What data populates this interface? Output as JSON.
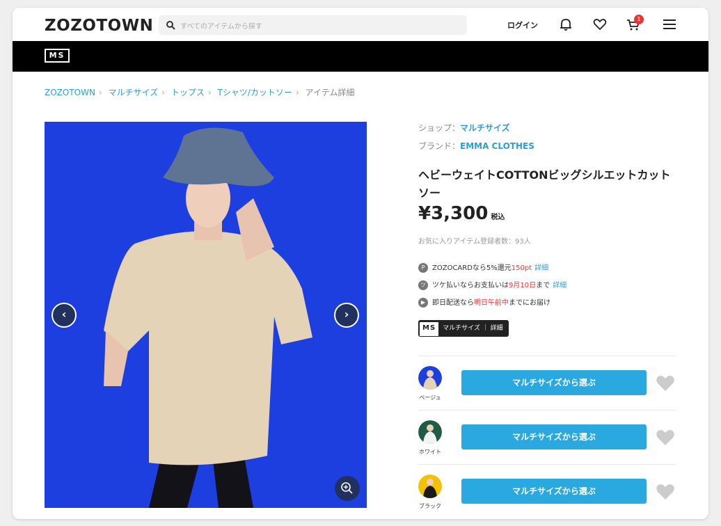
{
  "header": {
    "logo": "ZOZOTOWN",
    "search_placeholder": "すべてのアイテムから探す",
    "login_label": "ログイン",
    "cart_count": "1"
  },
  "msbar": {
    "logo": "MS"
  },
  "breadcrumb": [
    {
      "label": "ZOZOTOWN"
    },
    {
      "label": "マルチサイズ"
    },
    {
      "label": "トップス"
    },
    {
      "label": "Tシャツ/カットソー"
    },
    {
      "label": "アイテム詳細"
    }
  ],
  "product": {
    "shop_label": "ショップ：",
    "shop_value": "マルチサイズ",
    "brand_label": "ブランド：",
    "brand_value": "EMMA CLOTHES",
    "title": "ヘビーウェイトCOTTONビッグシルエットカットソー",
    "price": "¥3,300",
    "tax": "税込",
    "favorites": "お気に入りアイテム登録者数：93人",
    "perks": {
      "card_pre": "ZOZOCARDなら5%還元",
      "card_pt": "150pt",
      "card_link": "詳細",
      "tsuke_pre": "ツケ払いならお支払いは",
      "tsuke_date": "9月10日",
      "tsuke_post": "まで",
      "tsuke_link": "詳細",
      "ship_pre": "即日配送なら",
      "ship_red": "明日午前中",
      "ship_post": "までにお届け"
    },
    "ms_badge": {
      "ms": "MS",
      "text": "マルチサイズ ｜ 詳細"
    }
  },
  "variants": [
    {
      "label": "ベージュ",
      "button": "マルチサイズから選ぶ"
    },
    {
      "label": "ホワイト",
      "button": "マルチサイズから選ぶ"
    },
    {
      "label": "ブラック",
      "button": "マルチサイズから選ぶ"
    }
  ],
  "colors": {
    "accent": "#2aa9e0",
    "link": "#2a9fd6",
    "red": "#e33333",
    "photo_bg": "#1d3fe0"
  }
}
